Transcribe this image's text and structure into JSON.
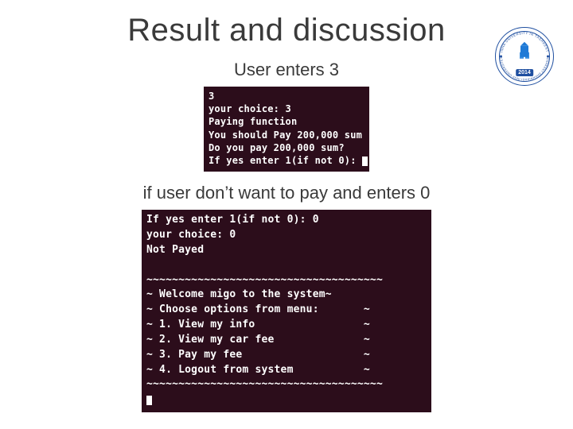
{
  "title": "Result and discussion",
  "caption1": "User enters 3",
  "caption2": "if user don’t want to pay and enters 0",
  "logo": {
    "top_text": "INHA UNIVERSITY IN TASHKENT",
    "bottom_text": "TOSHKENT SHAHRIDAGI INHA UNIVERSITETI",
    "year": "2014"
  },
  "terminal1": {
    "lines": [
      "3",
      "your choice: 3",
      "Paying function",
      "You should Pay 200,000 sum",
      "Do you pay 200,000 sum?",
      "If yes enter 1(if not 0): "
    ]
  },
  "terminal2": {
    "lines": [
      "If yes enter 1(if not 0): 0",
      "your choice: 0",
      "Not Payed",
      "",
      "~~~~~~~~~~~~~~~~~~~~~~~~~~~~~~~~~~~~~",
      "~ Welcome migo to the system~",
      "~ Choose options from menu:       ~",
      "~ 1. View my info                 ~",
      "~ 2. View my car fee              ~",
      "~ 3. Pay my fee                   ~",
      "~ 4. Logout from system           ~",
      "~~~~~~~~~~~~~~~~~~~~~~~~~~~~~~~~~~~~~"
    ]
  }
}
